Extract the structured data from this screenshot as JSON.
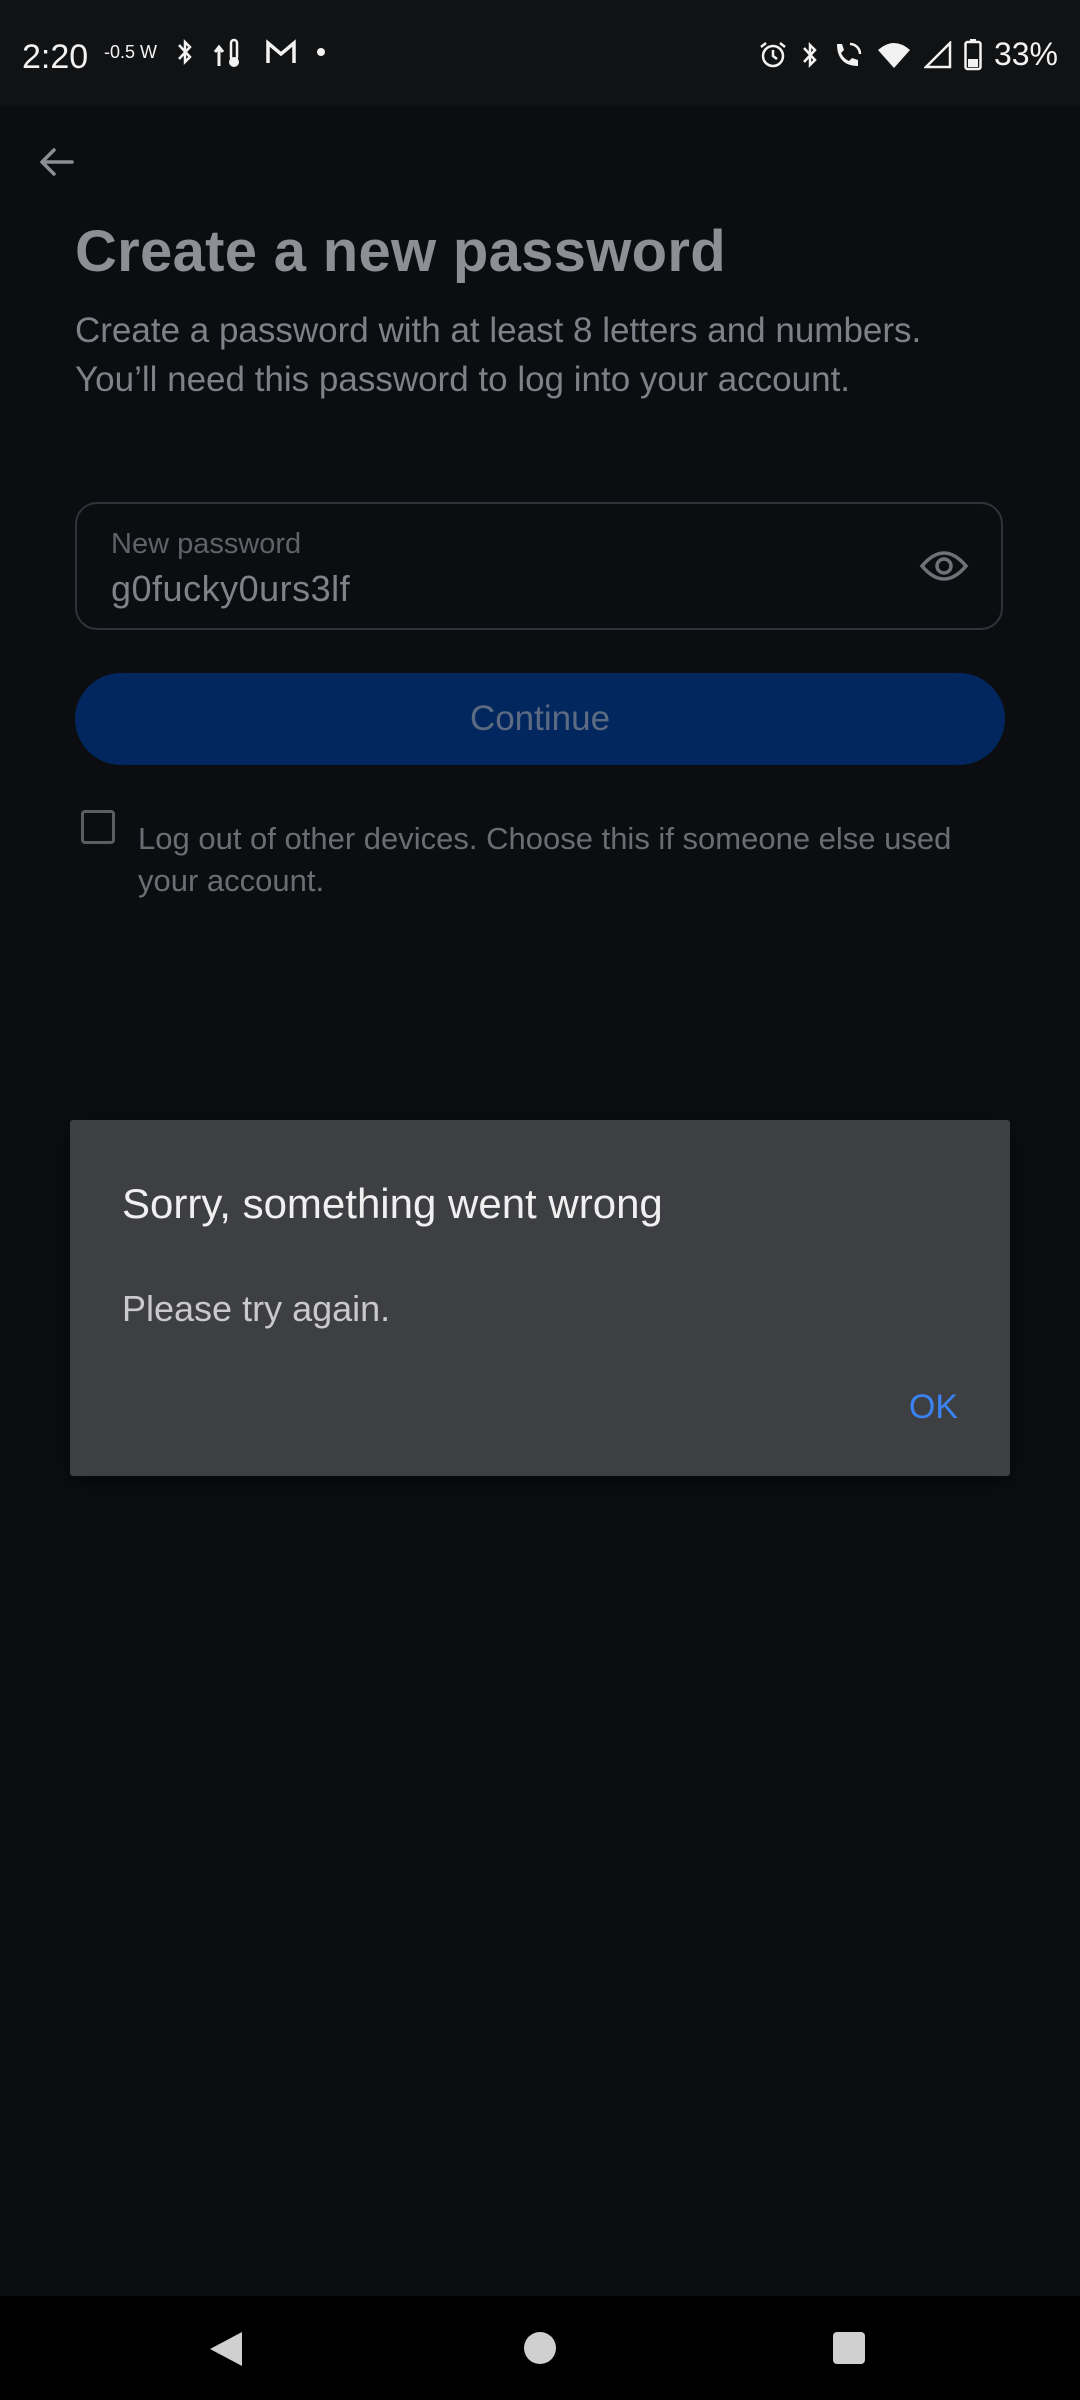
{
  "status_bar": {
    "time": "2:20",
    "battery": "33%",
    "left_icons": [
      "weather-w-icon",
      "bluetooth-icon",
      "data-temp-icon",
      "gmail-icon",
      "dot-icon"
    ],
    "right_icons": [
      "alarm-icon",
      "bluetooth-icon",
      "wifi-call-icon",
      "wifi-icon",
      "signal-icon",
      "battery-icon"
    ],
    "weather_badge": "-0.5 W"
  },
  "header": {
    "title": "Create a new password",
    "subtitle": "Create a password with at least 8 letters and numbers. You’ll need this password to log into your account."
  },
  "form": {
    "password_label": "New password",
    "password_value": "g0fucky0urs3lf",
    "continue_label": "Continue",
    "logout_label": "Log out of other devices. Choose this if someone else used your account."
  },
  "dialog": {
    "title": "Sorry, something went wrong",
    "message": "Please try again.",
    "ok_label": "OK"
  },
  "colors": {
    "background": "#0b0d11",
    "primary_button": "#02275e",
    "dialog_bg": "#3e3f42",
    "dialog_action": "#3a83f5"
  }
}
